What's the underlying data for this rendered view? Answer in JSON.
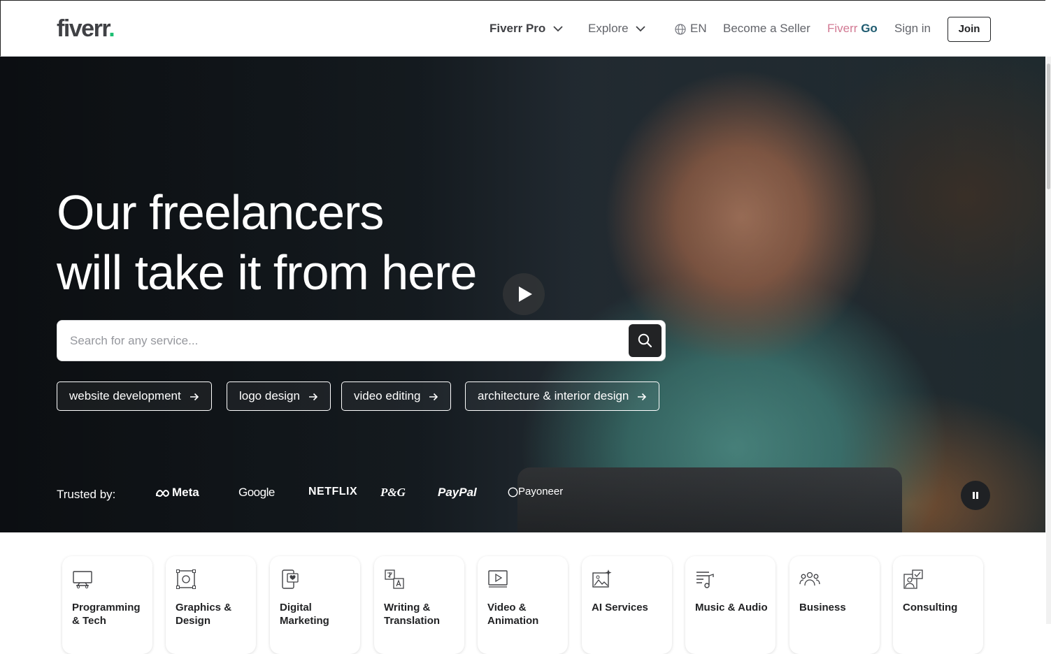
{
  "header": {
    "logo": "fiverr",
    "logo_dot": ".",
    "nav": {
      "fiverr_pro": "Fiverr Pro",
      "explore": "Explore",
      "language": "EN",
      "become_seller": "Become a Seller",
      "fiverr_go_a": "Fiverr",
      "fiverr_go_b": "Go",
      "sign_in": "Sign in",
      "join": "Join"
    }
  },
  "hero": {
    "headline_line1": "Our freelancers",
    "headline_line2": "will take it from here",
    "search": {
      "placeholder": "Search for any service..."
    },
    "chips": [
      {
        "label": "website development"
      },
      {
        "label": "logo design"
      },
      {
        "label": "video editing"
      },
      {
        "label": "architecture & interior design"
      }
    ],
    "trusted_label": "Trusted by:",
    "brands": [
      "Meta",
      "Google",
      "NETFLIX",
      "P&G",
      "PayPal",
      "Payoneer"
    ]
  },
  "categories": [
    {
      "label": "Programming & Tech",
      "icon": "monitor-icon"
    },
    {
      "label": "Graphics & Design",
      "icon": "graphics-icon"
    },
    {
      "label": "Digital Marketing",
      "icon": "phone-heart-icon"
    },
    {
      "label": "Writing & Translation",
      "icon": "translate-icon"
    },
    {
      "label": "Video & Animation",
      "icon": "video-icon"
    },
    {
      "label": "AI Services",
      "icon": "ai-image-icon"
    },
    {
      "label": "Music & Audio",
      "icon": "music-icon"
    },
    {
      "label": "Business",
      "icon": "people-icon"
    },
    {
      "label": "Consulting",
      "icon": "consulting-icon"
    }
  ],
  "colors": {
    "brand_green": "#1dbf73",
    "text_dark": "#404145",
    "go_pink": "#d27993",
    "go_blue": "#1e5b70"
  }
}
